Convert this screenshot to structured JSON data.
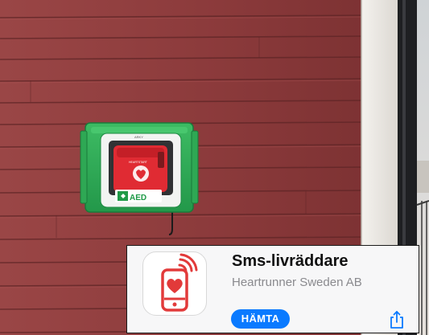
{
  "app_card": {
    "app_name": "Sms-livräddare",
    "developer": "Heartrunner Sweden AB",
    "get_label": "HÄMTA",
    "app_icon_name": "phone-heart-signal-icon",
    "share_icon_name": "share-icon",
    "accent_color": "#0a7aff",
    "icon_color": "#e23a3a"
  },
  "photo": {
    "wall_color": "#8e3b3b",
    "cabinet_color": "#2fae55",
    "cabinet_label": "AED",
    "cabinet_brand": "ARKY",
    "defibrillator_label": "HEARTSTART"
  }
}
